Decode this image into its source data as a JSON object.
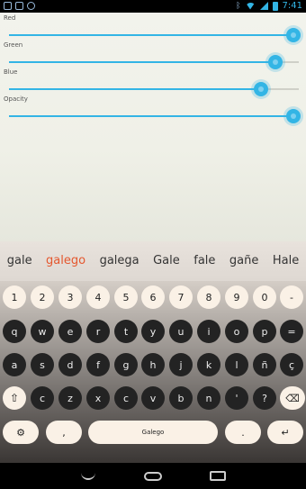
{
  "status_bar": {
    "time": "7:41",
    "icons": [
      "notification-icon",
      "bag-icon",
      "android-icon",
      "bluetooth-icon",
      "wifi-icon",
      "signal-icon",
      "battery-icon"
    ]
  },
  "sliders": [
    {
      "label": "Red",
      "value": 0.98
    },
    {
      "label": "Green",
      "value": 0.92
    },
    {
      "label": "Blue",
      "value": 0.87
    },
    {
      "label": "Opacity",
      "value": 0.98
    }
  ],
  "suggestions": [
    "gale",
    "galego",
    "galega",
    "Gale",
    "fale",
    "gañe",
    "Hale"
  ],
  "highlighted_suggestion": 1,
  "keyboard": {
    "numbers": [
      "1",
      "2",
      "3",
      "4",
      "5",
      "6",
      "7",
      "8",
      "9",
      "0",
      "-"
    ],
    "row1": [
      "q",
      "w",
      "e",
      "r",
      "t",
      "y",
      "u",
      "i",
      "o",
      "p",
      "="
    ],
    "row2": [
      "a",
      "s",
      "d",
      "f",
      "g",
      "h",
      "j",
      "k",
      "l",
      "ñ",
      "ç"
    ],
    "row3": [
      "c",
      "z",
      "x",
      "c",
      "v",
      "b",
      "n",
      "m",
      "'",
      "?"
    ],
    "shift": "⇧",
    "backspace": "⌫",
    "settings": "⚙",
    "comma": ",",
    "space_label": "Galego",
    "period": ".",
    "enter": "↵"
  },
  "colors": {
    "accent": "#33b5e5",
    "highlight": "#e4572e"
  }
}
